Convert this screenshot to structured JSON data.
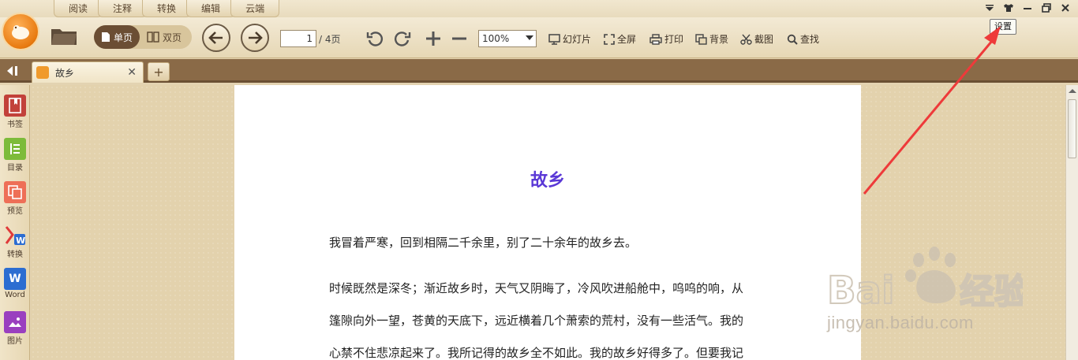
{
  "menu": {
    "tabs": [
      "阅读",
      "注释",
      "转换",
      "编辑",
      "云端"
    ]
  },
  "tooltip": "设置",
  "toolbar": {
    "view_single": "单页",
    "view_double": "双页",
    "page_current": "1",
    "page_total": "/ 4页",
    "zoom": "100%",
    "slideshow": "幻灯片",
    "fullscreen": "全屏",
    "print": "打印",
    "background": "背景",
    "screenshot": "截图",
    "find": "查找"
  },
  "tabs": {
    "active_doc": "故乡",
    "add": "+"
  },
  "sidebar": {
    "items": [
      {
        "label": "书签",
        "icon": "bookmark-icon",
        "color": "#c2413a"
      },
      {
        "label": "目录",
        "icon": "toc-icon",
        "color": "#7dbb3a"
      },
      {
        "label": "预览",
        "icon": "preview-icon",
        "color": "#ee6f57"
      },
      {
        "label": "转换",
        "icon": "convert-icon",
        "color": "#e8e0d0"
      },
      {
        "label": "Word",
        "icon": "word-icon",
        "color": "#2c6dd1"
      },
      {
        "label": "图片",
        "icon": "image-icon",
        "color": "#9a3fbf"
      }
    ]
  },
  "document": {
    "title": "故乡",
    "title_color": "#5a38d6",
    "p1": "我冒着严寒，回到相隔二千余里，别了二十余年的故乡去。",
    "p2_l1": "时候既然是深冬；渐近故乡时，天气又阴晦了，冷风吹进船舱中，呜呜的响，从",
    "p2_l2": "篷隙向外一望，苍黄的天底下，远近横着几个萧索的荒村，没有一些活气。我的",
    "p2_l3": "心禁不住悲凉起来了。我所记得的故乡全不如此。我的故乡好得多了。但要我记"
  },
  "watermark": {
    "brand": "Baidu经验",
    "url": "jingyan.baidu.com"
  },
  "colors": {
    "annotation_arrow": "#ee3a3a"
  }
}
